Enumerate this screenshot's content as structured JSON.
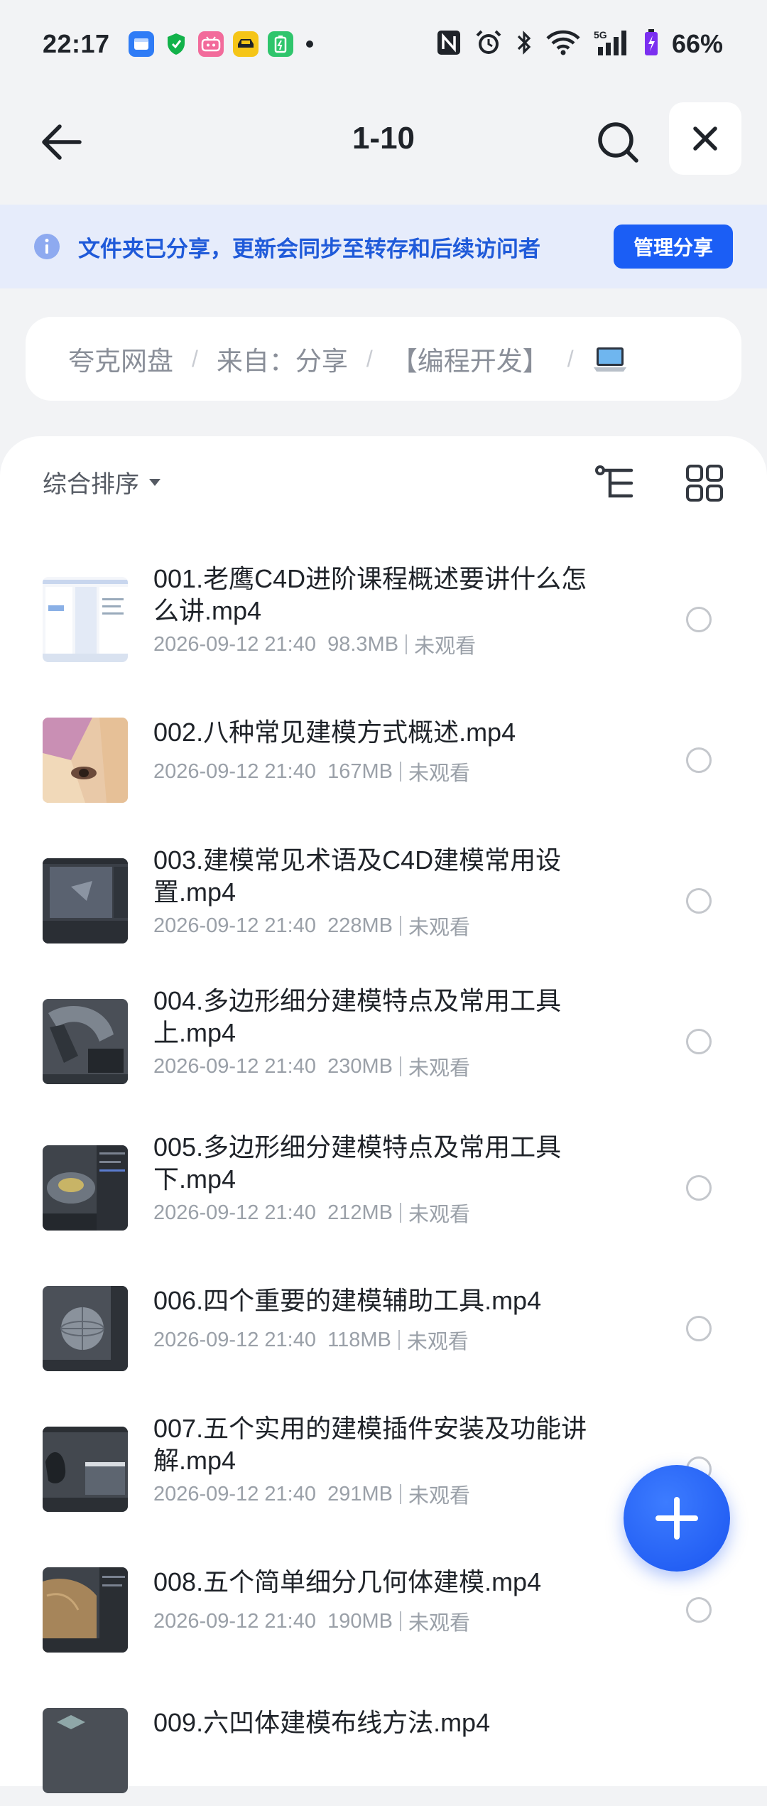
{
  "status_bar": {
    "time": "22:17",
    "battery_percent": "66%",
    "apps": [
      "files-app-icon",
      "shield-app-icon",
      "bilibili-app-icon",
      "car-app-icon",
      "battery-app-icon"
    ]
  },
  "header": {
    "title": "1-10"
  },
  "share_banner": {
    "text": "文件夹已分享，更新会同步至转存和后续访问者",
    "manage_label": "管理分享"
  },
  "breadcrumb": {
    "items": [
      "夸克网盘",
      "来自：分享",
      "【编程开发】"
    ],
    "separator": "/"
  },
  "list_toolbar": {
    "sort_label": "综合排序"
  },
  "files": [
    {
      "name": "001.老鹰C4D进阶课程概述要讲什么怎么讲.mp4",
      "date": "2026-09-12 21:40",
      "size": "98.3MB",
      "status": "未观看"
    },
    {
      "name": "002.八种常见建模方式概述.mp4",
      "date": "2026-09-12 21:40",
      "size": "167MB",
      "status": "未观看"
    },
    {
      "name": "003.建模常见术语及C4D建模常用设置.mp4",
      "date": "2026-09-12 21:40",
      "size": "228MB",
      "status": "未观看"
    },
    {
      "name": "004.多边形细分建模特点及常用工具上.mp4",
      "date": "2026-09-12 21:40",
      "size": "230MB",
      "status": "未观看"
    },
    {
      "name": "005.多边形细分建模特点及常用工具下.mp4",
      "date": "2026-09-12 21:40",
      "size": "212MB",
      "status": "未观看"
    },
    {
      "name": "006.四个重要的建模辅助工具.mp4",
      "date": "2026-09-12 21:40",
      "size": "118MB",
      "status": "未观看"
    },
    {
      "name": "007.五个实用的建模插件安装及功能讲解.mp4",
      "date": "2026-09-12 21:40",
      "size": "291MB",
      "status": "未观看"
    },
    {
      "name": "008.五个简单细分几何体建模.mp4",
      "date": "2026-09-12 21:40",
      "size": "190MB",
      "status": "未观看"
    },
    {
      "name": "009.六凹体建模布线方法.mp4",
      "date": "",
      "size": "",
      "status": ""
    }
  ],
  "colors": {
    "accent": "#1b5ef5",
    "banner_bg": "#e6ecfb",
    "banner_text": "#1f5ad9",
    "page_bg": "#f2f3f5"
  }
}
